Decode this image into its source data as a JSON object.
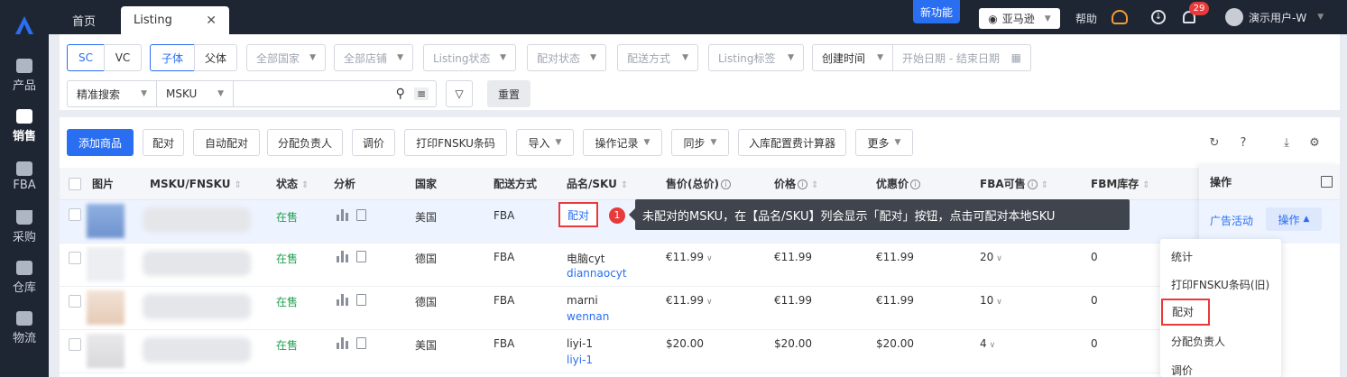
{
  "topbar": {
    "tabs": [
      {
        "label": "首页"
      },
      {
        "label": "Listing"
      }
    ],
    "close_glyph": "✕",
    "new_feature": "新功能",
    "marketplace": "亚马逊",
    "help": "帮助",
    "notification_count": "29",
    "user": "演示用户-W"
  },
  "sidebar": {
    "items": [
      {
        "label": "产品",
        "icon": "box-icon"
      },
      {
        "label": "销售",
        "icon": "sell-icon",
        "active": true
      },
      {
        "label": "FBA",
        "icon": "amazon-icon"
      },
      {
        "label": "采购",
        "icon": "cart-icon"
      },
      {
        "label": "仓库",
        "icon": "warehouse-icon"
      },
      {
        "label": "物流",
        "icon": "truck-icon"
      }
    ]
  },
  "filters": {
    "sc": "SC",
    "vc": "VC",
    "child": "子体",
    "parent": "父体",
    "country": "全部国家",
    "store": "全部店铺",
    "listing_status": "Listing状态",
    "pair_status": "配对状态",
    "ship_method": "配送方式",
    "listing_tag": "Listing标签",
    "created_time": "创建时间",
    "date_range": "开始日期 - 结束日期",
    "search_mode": "精准搜索",
    "search_field": "MSKU",
    "reset": "重置"
  },
  "toolbar": {
    "add": "添加商品",
    "pair": "配对",
    "auto_pair": "自动配对",
    "assign": "分配负责人",
    "reprice": "调价",
    "print": "打印FNSKU条码",
    "import": "导入",
    "oplog": "操作记录",
    "sync": "同步",
    "calc": "入库配置费计算器",
    "more": "更多"
  },
  "table": {
    "headers": {
      "image": "图片",
      "msku": "MSKU/FNSKU",
      "status": "状态",
      "analysis": "分析",
      "country": "国家",
      "ship": "配送方式",
      "name_sku": "品名/SKU",
      "sale_price": "售价(总价)",
      "price": "价格",
      "discount": "优惠价",
      "fba_stock": "FBA可售",
      "fbm_stock": "FBM库存",
      "ops": "操作"
    },
    "rows": [
      {
        "status": "在售",
        "country": "美国",
        "ship": "FBA",
        "name": "",
        "sku": "配对",
        "sale_price": "",
        "price": "",
        "discount": "",
        "fba": "",
        "fbm": ""
      },
      {
        "status": "在售",
        "country": "德国",
        "ship": "FBA",
        "name": "电脑cyt",
        "sku": "diannaocyt",
        "sale_price": "€11.99",
        "price": "€11.99",
        "discount": "€11.99",
        "fba": "20",
        "fbm": "0"
      },
      {
        "status": "在售",
        "country": "德国",
        "ship": "FBA",
        "name": "marni",
        "sku": "wennan",
        "sale_price": "€11.99",
        "price": "€11.99",
        "discount": "€11.99",
        "fba": "10",
        "fbm": "0"
      },
      {
        "status": "在售",
        "country": "美国",
        "ship": "FBA",
        "name": "liyi-1",
        "sku": "liyi-1",
        "sale_price": "$20.00",
        "price": "$20.00",
        "discount": "$20.00",
        "fba": "4",
        "fbm": "0"
      }
    ],
    "ad_link": "广告活动",
    "op_button": "操作"
  },
  "tooltip": {
    "step": "1",
    "text": "未配对的MSKU，在【品名/SKU】列会显示「配对」按钮，点击可配对本地SKU"
  },
  "dropdown": {
    "items": [
      "统计",
      "打印FNSKU条码(旧)",
      "配对",
      "分配负责人",
      "调价"
    ]
  },
  "colors": {
    "accent": "#2a6ef2",
    "sidebar": "#1f2633",
    "highlight": "#e83a3a",
    "status_green": "#20a050"
  }
}
